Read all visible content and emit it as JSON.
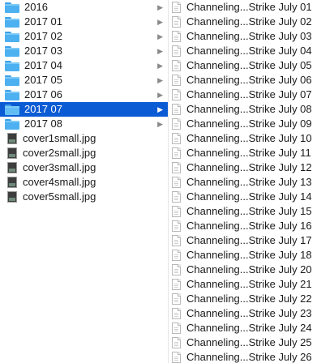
{
  "left_column": {
    "folders": [
      {
        "label": "2016"
      },
      {
        "label": "2017 01"
      },
      {
        "label": "2017 02"
      },
      {
        "label": "2017 03"
      },
      {
        "label": "2017 04"
      },
      {
        "label": "2017 05"
      },
      {
        "label": "2017 06"
      },
      {
        "label": "2017 07",
        "selected": true
      },
      {
        "label": "2017 08"
      }
    ],
    "files": [
      {
        "label": "cover1small.jpg"
      },
      {
        "label": "cover2small.jpg"
      },
      {
        "label": "cover3small.jpg"
      },
      {
        "label": "cover4small.jpg"
      },
      {
        "label": "cover5small.jpg"
      }
    ]
  },
  "right_column": {
    "files": [
      {
        "label": "Channeling...Strike July 01"
      },
      {
        "label": "Channeling...Strike July 02"
      },
      {
        "label": "Channeling...Strike July 03"
      },
      {
        "label": "Channeling...Strike July 04"
      },
      {
        "label": "Channeling...Strike July 05"
      },
      {
        "label": "Channeling...Strike July 06"
      },
      {
        "label": "Channeling...Strike July 07"
      },
      {
        "label": "Channeling...Strike July 08"
      },
      {
        "label": "Channeling...Strike July 09"
      },
      {
        "label": "Channeling...Strike July 10"
      },
      {
        "label": "Channeling...Strike July 11"
      },
      {
        "label": "Channeling...Strike July 12"
      },
      {
        "label": "Channeling...Strike July 13"
      },
      {
        "label": "Channeling...Strike July 14"
      },
      {
        "label": "Channeling...Strike July 15"
      },
      {
        "label": "Channeling...Strike July 16"
      },
      {
        "label": "Channeling...Strike July 17"
      },
      {
        "label": "Channeling...Strike July 18"
      },
      {
        "label": "Channeling...Strike July 20"
      },
      {
        "label": "Channeling...Strike July 21"
      },
      {
        "label": "Channeling...Strike July 22"
      },
      {
        "label": "Channeling...Strike July 23"
      },
      {
        "label": "Channeling...Strike July 24"
      },
      {
        "label": "Channeling...Strike July 25"
      },
      {
        "label": "Channeling...Strike July 26"
      }
    ]
  },
  "colors": {
    "selection": "#0a5bd4",
    "folder": "#4db0f1"
  },
  "icons": {
    "folder": "folder-icon",
    "image_file": "image-file-icon",
    "document": "document-icon",
    "disclosure": "chevron-right-icon"
  }
}
